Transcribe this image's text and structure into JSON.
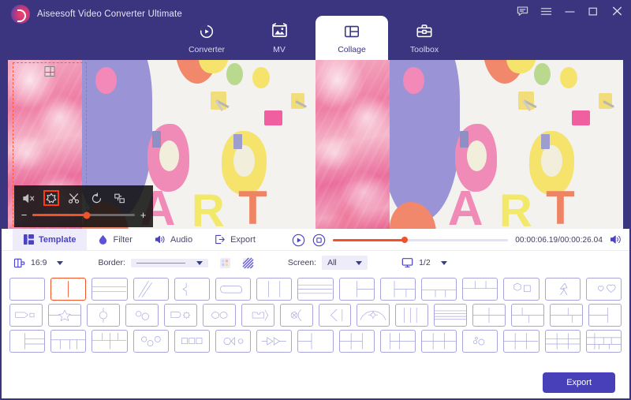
{
  "app": {
    "title": "Aiseesoft Video Converter Ultimate",
    "brand_color": "#3b3580",
    "accent_color": "#f0522a",
    "export_color": "#4740b8"
  },
  "window_controls": [
    {
      "name": "feedback-icon",
      "label": "Feedback"
    },
    {
      "name": "menu-icon",
      "label": "Menu"
    },
    {
      "name": "minimize-icon",
      "label": "Minimize"
    },
    {
      "name": "maximize-icon",
      "label": "Maximize"
    },
    {
      "name": "close-icon",
      "label": "Close"
    }
  ],
  "nav_tabs": [
    {
      "label": "Converter",
      "icon": "converter-icon",
      "active": false
    },
    {
      "label": "MV",
      "icon": "mv-icon",
      "active": false
    },
    {
      "label": "Collage",
      "icon": "collage-icon",
      "active": true
    },
    {
      "label": "Toolbox",
      "icon": "toolbox-icon",
      "active": false
    }
  ],
  "clip_toolbar": {
    "buttons": [
      {
        "name": "mute-icon",
        "label": "Mute",
        "selected": false
      },
      {
        "name": "filter-icon",
        "label": "Filter",
        "selected": true
      },
      {
        "name": "trim-scissors-icon",
        "label": "Trim",
        "selected": false
      },
      {
        "name": "rotate-icon",
        "label": "Rotate",
        "selected": false
      },
      {
        "name": "crop-icon",
        "label": "Crop",
        "selected": false
      }
    ],
    "zoom_minus": "−",
    "zoom_plus": "+",
    "zoom_percent": 53
  },
  "panel_tabs": [
    {
      "label": "Template",
      "icon": "template-icon",
      "active": true
    },
    {
      "label": "Filter",
      "icon": "filter-drop-icon",
      "active": false
    },
    {
      "label": "Audio",
      "icon": "audio-speaker-icon",
      "active": false
    },
    {
      "label": "Export",
      "icon": "export-arrow-icon",
      "active": false
    }
  ],
  "playback": {
    "play_label": "Play",
    "stop_label": "Stop",
    "progress_percent": 41,
    "time": "00:00:06.19/00:00:26.04",
    "current_time": "00:00:06.19",
    "total_time": "00:00:26.04",
    "volume_label": "Volume"
  },
  "options": {
    "aspect_ratio_icon": "aspect-ratio-icon",
    "aspect_ratio_value": "16:9",
    "border_label": "Border:",
    "border_style_value": "solid-line",
    "border_buttons": [
      {
        "name": "border-color-icon",
        "label": "Border color"
      },
      {
        "name": "border-pattern-icon",
        "label": "Border pattern"
      }
    ],
    "screen_label": "Screen:",
    "screen_value": "All",
    "monitor_icon": "monitor-icon",
    "page_value": "1/2"
  },
  "templates": {
    "selected_index": 1,
    "rows": [
      [
        {
          "id": "t1",
          "kind": "single"
        },
        {
          "id": "t2",
          "kind": "split-vertical-2"
        },
        {
          "id": "t3",
          "kind": "h-band-3"
        },
        {
          "id": "t4",
          "kind": "diagonal-slash"
        },
        {
          "id": "t5",
          "kind": "arrow-notch"
        },
        {
          "id": "t6",
          "kind": "rounded-inset"
        },
        {
          "id": "t7",
          "kind": "cols-3"
        },
        {
          "id": "t8",
          "kind": "rows-4"
        },
        {
          "id": "t9",
          "kind": "left-big-right-2"
        },
        {
          "id": "t10",
          "kind": "left-2-right-split"
        },
        {
          "id": "t11",
          "kind": "bottom-split-3"
        },
        {
          "id": "t12",
          "kind": "top-split-3"
        },
        {
          "id": "t13",
          "kind": "hex-square"
        },
        {
          "id": "t14",
          "kind": "lightning-split"
        },
        {
          "id": "t15",
          "kind": "two-hearts"
        }
      ],
      [
        {
          "id": "t16",
          "kind": "flag-rect"
        },
        {
          "id": "t17",
          "kind": "star-band"
        },
        {
          "id": "t18",
          "kind": "circle-center"
        },
        {
          "id": "t19",
          "kind": "two-circles"
        },
        {
          "id": "t20",
          "kind": "gear-shape"
        },
        {
          "id": "t21",
          "kind": "oval-pair"
        },
        {
          "id": "t22",
          "kind": "puzzle-shape"
        },
        {
          "id": "t23",
          "kind": "cross-circle"
        },
        {
          "id": "t24",
          "kind": "chevron-left"
        },
        {
          "id": "t25",
          "kind": "arch-diamond"
        },
        {
          "id": "t26",
          "kind": "cols-4"
        },
        {
          "id": "t27",
          "kind": "rows-5"
        },
        {
          "id": "t28",
          "kind": "quad-4"
        },
        {
          "id": "t29",
          "kind": "left-big-right-stack"
        },
        {
          "id": "t30",
          "kind": "t-shape-3"
        },
        {
          "id": "t31",
          "kind": "left-rows-right-big"
        }
      ],
      [
        {
          "id": "t32",
          "kind": "left-big-right-rows3"
        },
        {
          "id": "t33",
          "kind": "top-band-bottom-3"
        },
        {
          "id": "t34",
          "kind": "top-3-bottom-band"
        },
        {
          "id": "t35",
          "kind": "three-circles"
        },
        {
          "id": "t36",
          "kind": "three-squares"
        },
        {
          "id": "t37",
          "kind": "circle-arrow-dot"
        },
        {
          "id": "t38",
          "kind": "arrow-chain"
        },
        {
          "id": "t39",
          "kind": "grid-2x2-wide"
        },
        {
          "id": "t40",
          "kind": "left-split-right-2"
        },
        {
          "id": "t41",
          "kind": "grid-2x3-a"
        },
        {
          "id": "t42",
          "kind": "cols-3-rows-2"
        },
        {
          "id": "t43",
          "kind": "bubbles"
        },
        {
          "id": "t44",
          "kind": "grid-2x3-b"
        },
        {
          "id": "t45",
          "kind": "grid-3x3"
        },
        {
          "id": "t46",
          "kind": "grid-complex"
        }
      ]
    ]
  },
  "footer": {
    "export_label": "Export"
  },
  "preview": {
    "left_pane_label": "Source preview",
    "right_pane_label": "Output preview",
    "letters": [
      "A",
      "R",
      "T"
    ]
  }
}
